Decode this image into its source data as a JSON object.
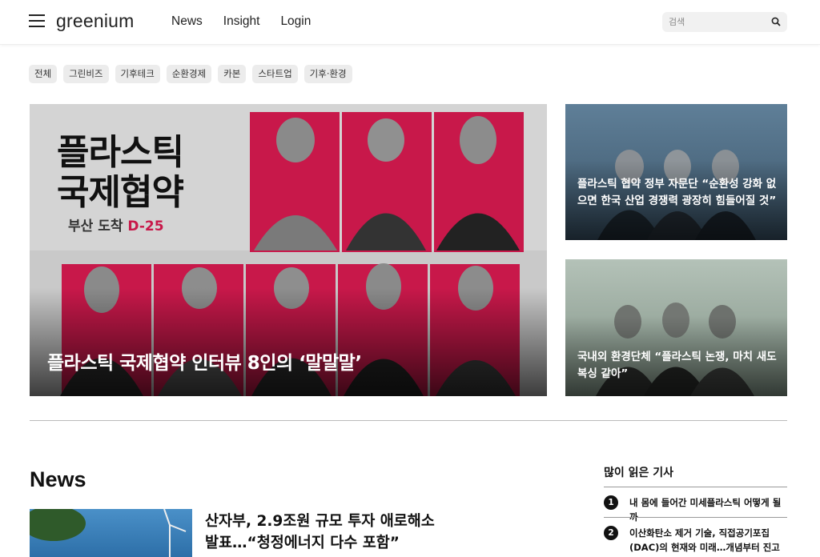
{
  "header": {
    "logo": "greenium",
    "nav": [
      "News",
      "Insight",
      "Login"
    ],
    "search_placeholder": "검색"
  },
  "categories": [
    "전체",
    "그린비즈",
    "기후테크",
    "순환경제",
    "카본",
    "스타트업",
    "기후·환경"
  ],
  "hero": {
    "art_title_line1": "플라스틱",
    "art_title_line2": "국제협약",
    "art_sub_prefix": "부산 도착 ",
    "art_sub_dday": "D-25",
    "headline": "플라스틱 국제협약 인터뷰 8인의 ‘말말말’"
  },
  "side_cards": [
    {
      "title": "플라스틱 협약 정부 자문단 “순환성 강화 없으면 한국 산업 경쟁력 광장히 힘들어질 것”"
    },
    {
      "title": "국내외 환경단체 “플라스틱 논쟁, 마치 새도복싱 같아”"
    }
  ],
  "news": {
    "heading": "News",
    "first_title": "산자부, 2.9조원 규모 투자 애로해소 발표…“청정에너지 다수 포함”"
  },
  "popular": {
    "heading": "많이 읽은 기사",
    "items": [
      {
        "rank": "1",
        "title": "내 몸에 들어간 미세플라스틱 어떻게 될까"
      },
      {
        "rank": "2",
        "title": "이산화탄소 제거 기술, 직접공기포집(DAC)의 현재와 미래…개념부터 진고"
      }
    ]
  },
  "colors": {
    "accent_red": "#c8184a",
    "chip_bg": "#ececec"
  }
}
